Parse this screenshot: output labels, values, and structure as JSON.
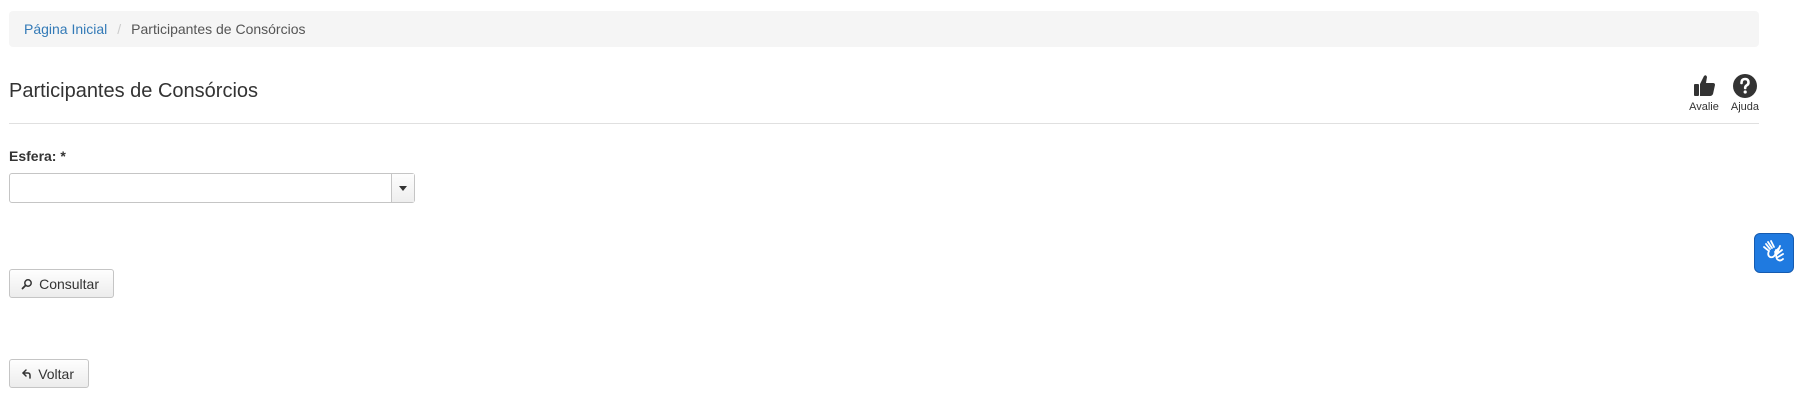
{
  "breadcrumb": {
    "home": "Página Inicial",
    "separator": "/",
    "current": "Participantes de Consórcios"
  },
  "page": {
    "title": "Participantes de Consórcios"
  },
  "header_actions": {
    "rate_label": "Avalie",
    "help_label": "Ajuda"
  },
  "form": {
    "esfera_label": "Esfera: *",
    "esfera_value": ""
  },
  "buttons": {
    "consultar": "Consultar",
    "voltar": "Voltar"
  },
  "icons": {
    "rate": "thumbs-up-icon",
    "help": "question-circle-icon",
    "search": "search-icon",
    "back": "back-arrow-icon",
    "accessibility": "sign-language-hands-icon"
  },
  "colors": {
    "link": "#337ab7",
    "accessibility_button": "#1f7ae0"
  }
}
